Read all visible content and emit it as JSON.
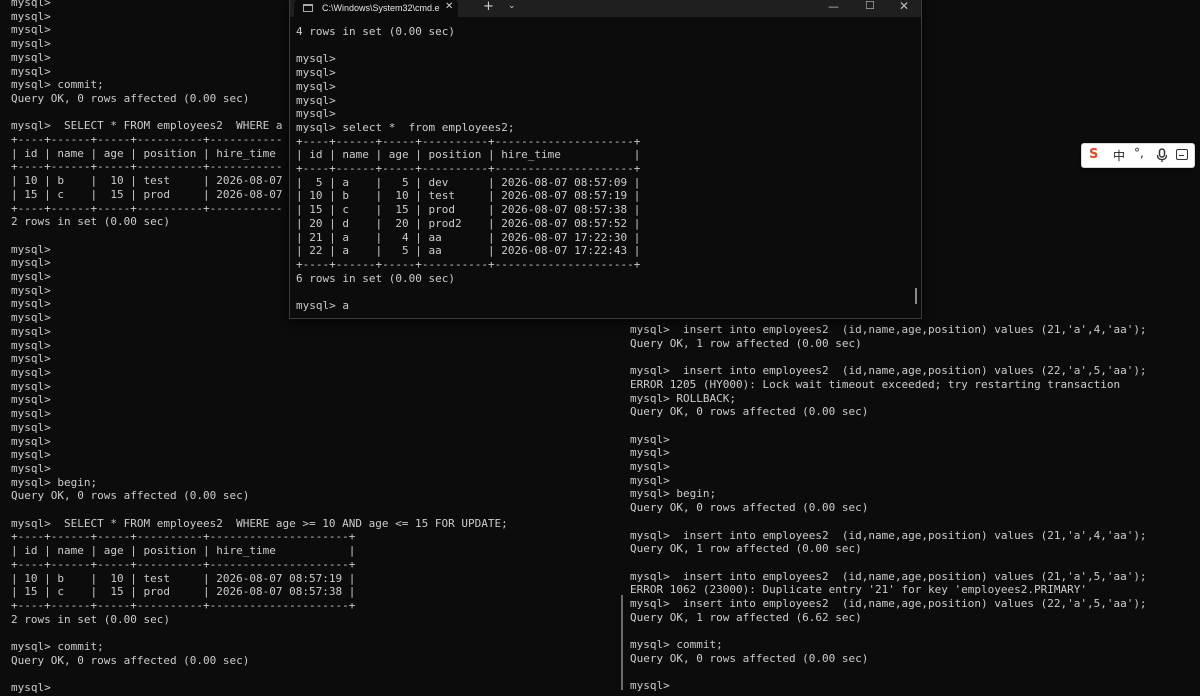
{
  "left_terminal": {
    "text": "mysql>\nmysql>\nmysql>\nmysql>\nmysql>\nmysql>\nmysql> commit;\nQuery OK, 0 rows affected (0.00 sec)\n\nmysql>  SELECT * FROM employees2  WHERE a\n+----+------+-----+----------+-----------\n| id | name | age | position | hire_time\n+----+------+-----+----------+-----------\n| 10 | b    |  10 | test     | 2026-08-07\n| 15 | c    |  15 | prod     | 2026-08-07\n+----+------+-----+----------+-----------\n2 rows in set (0.00 sec)\n\nmysql>\nmysql>\nmysql>\nmysql>\nmysql>\nmysql>\nmysql>\nmysql>\nmysql>\nmysql>\nmysql>\nmysql>\nmysql>\nmysql>\nmysql>\nmysql>\nmysql>\nmysql> begin;\nQuery OK, 0 rows affected (0.00 sec)\n\nmysql>  SELECT * FROM employees2  WHERE age >= 10 AND age <= 15 FOR UPDATE;\n+----+------+-----+----------+---------------------+\n| id | name | age | position | hire_time           |\n+----+------+-----+----------+---------------------+\n| 10 | b    |  10 | test     | 2026-08-07 08:57:19 |\n| 15 | c    |  15 | prod     | 2026-08-07 08:57:38 |\n+----+------+-----+----------+---------------------+\n2 rows in set (0.00 sec)\n\nmysql> commit;\nQuery OK, 0 rows affected (0.00 sec)\n\nmysql>"
  },
  "right_terminal": {
    "text": "mysql>  insert into employees2  (id,name,age,position) values (21,'a',4,'aa');\nQuery OK, 1 row affected (0.00 sec)\n\nmysql>  insert into employees2  (id,name,age,position) values (22,'a',5,'aa');\nERROR 1205 (HY000): Lock wait timeout exceeded; try restarting transaction\nmysql> ROLLBACK;\nQuery OK, 0 rows affected (0.00 sec)\n\nmysql>\nmysql>\nmysql>\nmysql>\nmysql> begin;\nQuery OK, 0 rows affected (0.00 sec)\n\nmysql>  insert into employees2  (id,name,age,position) values (21,'a',4,'aa');\nQuery OK, 1 row affected (0.00 sec)\n\nmysql>  insert into employees2  (id,name,age,position) values (21,'a',5,'aa');\nERROR 1062 (23000): Duplicate entry '21' for key 'employees2.PRIMARY'\nmysql>  insert into employees2  (id,name,age,position) values (22,'a',5,'aa');\nQuery OK, 1 row affected (6.62 sec)\n\nmysql> commit;\nQuery OK, 0 rows affected (0.00 sec)\n\nmysql>"
  },
  "cmd_window": {
    "tab_title": "C:\\Windows\\System32\\cmd.e",
    "tab_close_glyph": "✕",
    "new_tab_glyph": "+",
    "dropdown_glyph": "⌄",
    "minimize_glyph": "—",
    "maximize_glyph": "☐",
    "close_glyph": "✕",
    "text": "4 rows in set (0.00 sec)\n\nmysql>\nmysql>\nmysql>\nmysql>\nmysql>\nmysql> select *  from employees2;\n+----+------+-----+----------+---------------------+\n| id | name | age | position | hire_time           |\n+----+------+-----+----------+---------------------+\n|  5 | a    |   5 | dev      | 2026-08-07 08:57:09 |\n| 10 | b    |  10 | test     | 2026-08-07 08:57:19 |\n| 15 | c    |  15 | prod     | 2026-08-07 08:57:38 |\n| 20 | d    |  20 | prod2    | 2026-08-07 08:57:52 |\n| 21 | a    |   4 | aa       | 2026-08-07 17:22:30 |\n| 22 | a    |   5 | aa       | 2026-08-07 17:22:43 |\n+----+------+-----+----------+---------------------+\n6 rows in set (0.00 sec)\n\nmysql> a"
  },
  "ime_toolbar": {
    "logo": "S",
    "language": "中",
    "punctuation": "°,",
    "mic_icon": "microphone-icon",
    "keyboard_icon": "keyboard-icon",
    "logo_color": "#e8491d"
  }
}
